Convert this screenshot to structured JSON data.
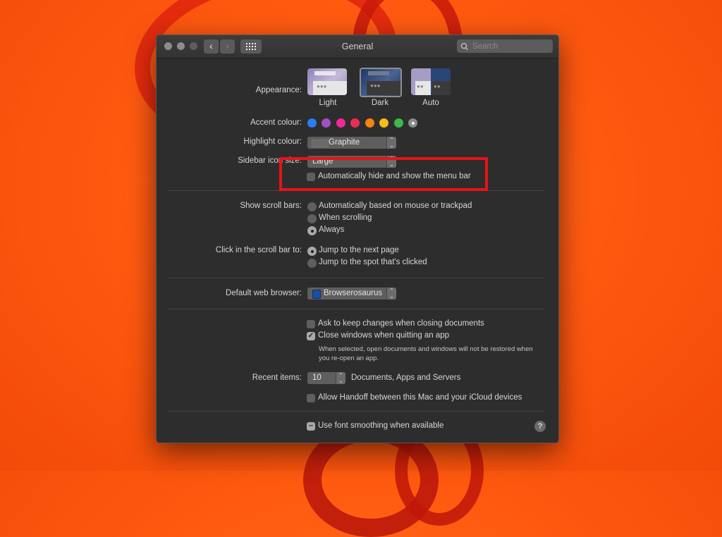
{
  "window": {
    "title": "General",
    "search_placeholder": "Search",
    "traffic_lights": [
      "close",
      "minimize",
      "zoom"
    ]
  },
  "appearance": {
    "label": "Appearance:",
    "options": [
      {
        "name": "Light",
        "selected": false
      },
      {
        "name": "Dark",
        "selected": true
      },
      {
        "name": "Auto",
        "selected": false
      }
    ]
  },
  "accent": {
    "label": "Accent colour:",
    "colors": [
      "#2a7df4",
      "#a34ec6",
      "#ee2a9a",
      "#ee2d54",
      "#f6820f",
      "#f8bc16",
      "#3cb94a",
      "#8c8c8c"
    ],
    "selected_index": 7
  },
  "highlight": {
    "label": "Highlight colour:",
    "value": "Graphite"
  },
  "sidebar_icon": {
    "label": "Sidebar icon size:",
    "value": "Large"
  },
  "menu_bar": {
    "label": "Automatically hide and show the menu bar",
    "checked": false
  },
  "scroll_bars": {
    "label": "Show scroll bars:",
    "options": [
      "Automatically based on mouse or trackpad",
      "When scrolling",
      "Always"
    ],
    "selected_index": 2
  },
  "click_scroll": {
    "label": "Click in the scroll bar to:",
    "options": [
      "Jump to the next page",
      "Jump to the spot that's clicked"
    ],
    "selected_index": 0
  },
  "browser": {
    "label": "Default web browser:",
    "value": "Browserosaurus"
  },
  "documents": {
    "ask_keep": {
      "label": "Ask to keep changes when closing documents",
      "checked": false
    },
    "close_windows": {
      "label": "Close windows when quitting an app",
      "checked": true
    },
    "note": "When selected, open documents and windows will not be restored when you re-open an app."
  },
  "recent": {
    "label": "Recent items:",
    "value": "10",
    "suffix": "Documents, Apps and Servers"
  },
  "handoff": {
    "label": "Allow Handoff between this Mac and your iCloud devices",
    "checked": false
  },
  "font_smoothing": {
    "label": "Use font smoothing when available",
    "state": "mixed"
  },
  "annotation": {
    "color": "#e8121a"
  }
}
